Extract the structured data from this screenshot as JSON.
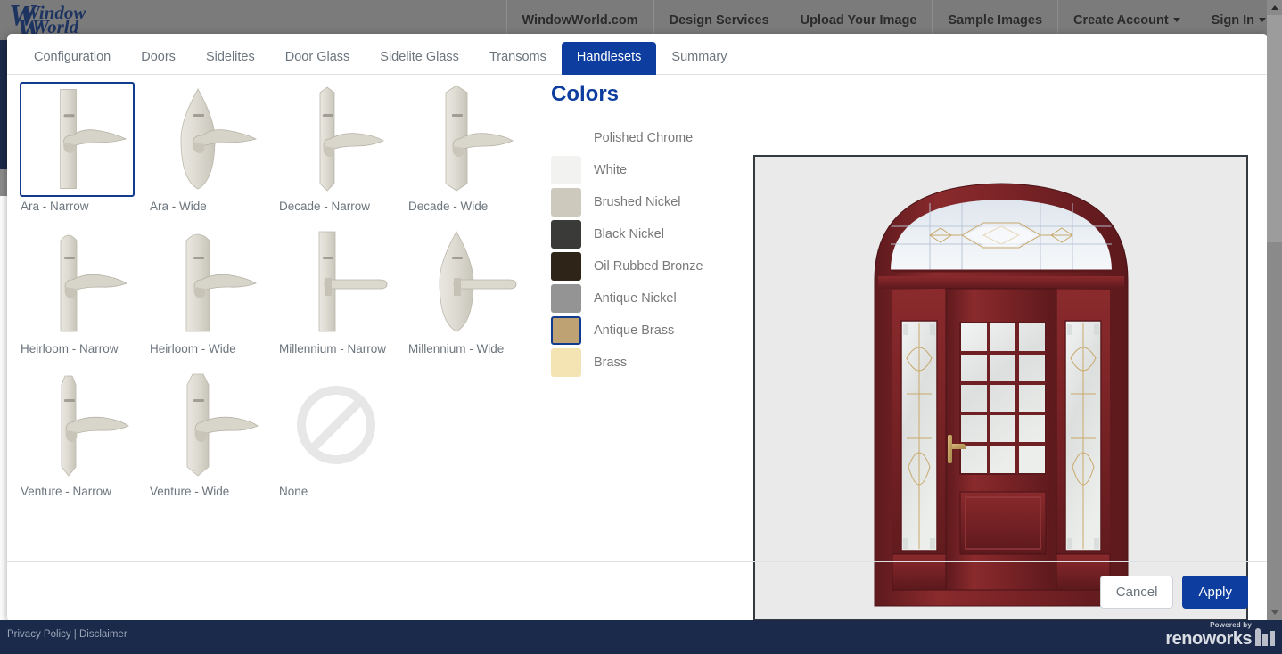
{
  "site": {
    "logo_line1": "Window",
    "logo_line2": "World",
    "nav": [
      {
        "label": "WindowWorld.com",
        "caret": false
      },
      {
        "label": "Design Services",
        "caret": false
      },
      {
        "label": "Upload Your Image",
        "caret": false
      },
      {
        "label": "Sample Images",
        "caret": false
      },
      {
        "label": "Create Account",
        "caret": true
      },
      {
        "label": "Sign In",
        "caret": true
      }
    ]
  },
  "modal": {
    "tabs": [
      {
        "label": "Configuration",
        "active": false
      },
      {
        "label": "Doors",
        "active": false
      },
      {
        "label": "Sidelites",
        "active": false
      },
      {
        "label": "Door Glass",
        "active": false
      },
      {
        "label": "Sidelite Glass",
        "active": false
      },
      {
        "label": "Transoms",
        "active": false
      },
      {
        "label": "Handlesets",
        "active": true
      },
      {
        "label": "Summary",
        "active": false
      }
    ],
    "handlesets": [
      {
        "label": "Ara - Narrow",
        "style": "narrow-flat",
        "lever": "ara",
        "selected": true
      },
      {
        "label": "Ara - Wide",
        "style": "oval",
        "lever": "ara",
        "selected": false
      },
      {
        "label": "Decade - Narrow",
        "style": "narrow-point",
        "lever": "decade",
        "selected": false
      },
      {
        "label": "Decade - Wide",
        "style": "wide-point",
        "lever": "decade",
        "selected": false
      },
      {
        "label": "Heirloom - Narrow",
        "style": "narrow-arch",
        "lever": "heirloom",
        "selected": false
      },
      {
        "label": "Heirloom - Wide",
        "style": "wide-arch",
        "lever": "heirloom",
        "selected": false
      },
      {
        "label": "Millennium - Narrow",
        "style": "narrow-flat",
        "lever": "millennium",
        "selected": false
      },
      {
        "label": "Millennium - Wide",
        "style": "oval",
        "lever": "millennium",
        "selected": false
      },
      {
        "label": "Venture - Narrow",
        "style": "narrow-crown",
        "lever": "venture",
        "selected": false
      },
      {
        "label": "Venture - Wide",
        "style": "wide-crown",
        "lever": "venture",
        "selected": false
      },
      {
        "label": "None",
        "style": "none",
        "lever": "none",
        "selected": false
      }
    ],
    "colors_title": "Colors",
    "colors": [
      {
        "label": "Polished Chrome",
        "hex": "#ffffff",
        "selected": false
      },
      {
        "label": "White",
        "hex": "#f2f2f0",
        "selected": false
      },
      {
        "label": "Brushed Nickel",
        "hex": "#cdc9bc",
        "selected": false
      },
      {
        "label": "Black Nickel",
        "hex": "#3a3a38",
        "selected": false
      },
      {
        "label": "Oil Rubbed Bronze",
        "hex": "#2e2418",
        "selected": false
      },
      {
        "label": "Antique Nickel",
        "hex": "#949494",
        "selected": false
      },
      {
        "label": "Antique Brass",
        "hex": "#bfa273",
        "selected": true
      },
      {
        "label": "Brass",
        "hex": "#f4e4b4",
        "selected": false
      }
    ],
    "cancel_label": "Cancel",
    "apply_label": "Apply"
  },
  "preview": {
    "door_color": "#7b2326",
    "handle_color": "#c2a264",
    "glass_color": "#e6e8e6"
  },
  "footer": {
    "privacy": "Privacy Policy",
    "separator": "|",
    "disclaimer": "Disclaimer",
    "powered_by": "Powered by",
    "brand": "renoworks"
  }
}
